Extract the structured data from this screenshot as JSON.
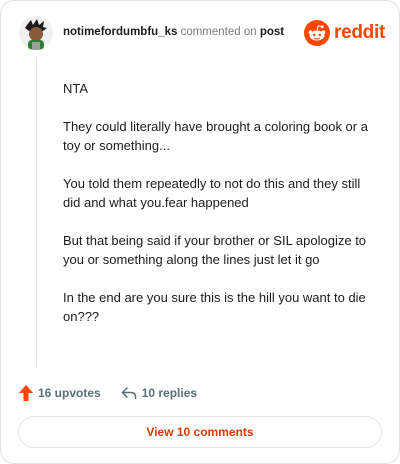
{
  "header": {
    "username": "notimefordumbfu_ks",
    "commented_text": "commented on",
    "post_link": "post",
    "brand_name": "reddit"
  },
  "comment": {
    "paragraphs": [
      "NTA",
      "They could literally have brought a coloring book or a toy or something...",
      "You told them repeatedly to not do this and they still did and what you.fear happened",
      "But that being said if your brother or SIL apologize to you or something along the lines just let it go",
      "In the end are you sure this is the hill you want to die on???"
    ]
  },
  "actions": {
    "upvotes": "16 upvotes",
    "replies": "10 replies"
  },
  "footer": {
    "view_comments": "View 10 comments"
  },
  "colors": {
    "accent": "#ff4500",
    "link": "#d93a00",
    "muted": "#576f76"
  },
  "icons": {
    "upvote": "upvote-arrow-icon",
    "reply": "reply-arrow-icon",
    "brand": "reddit-logo-icon"
  }
}
